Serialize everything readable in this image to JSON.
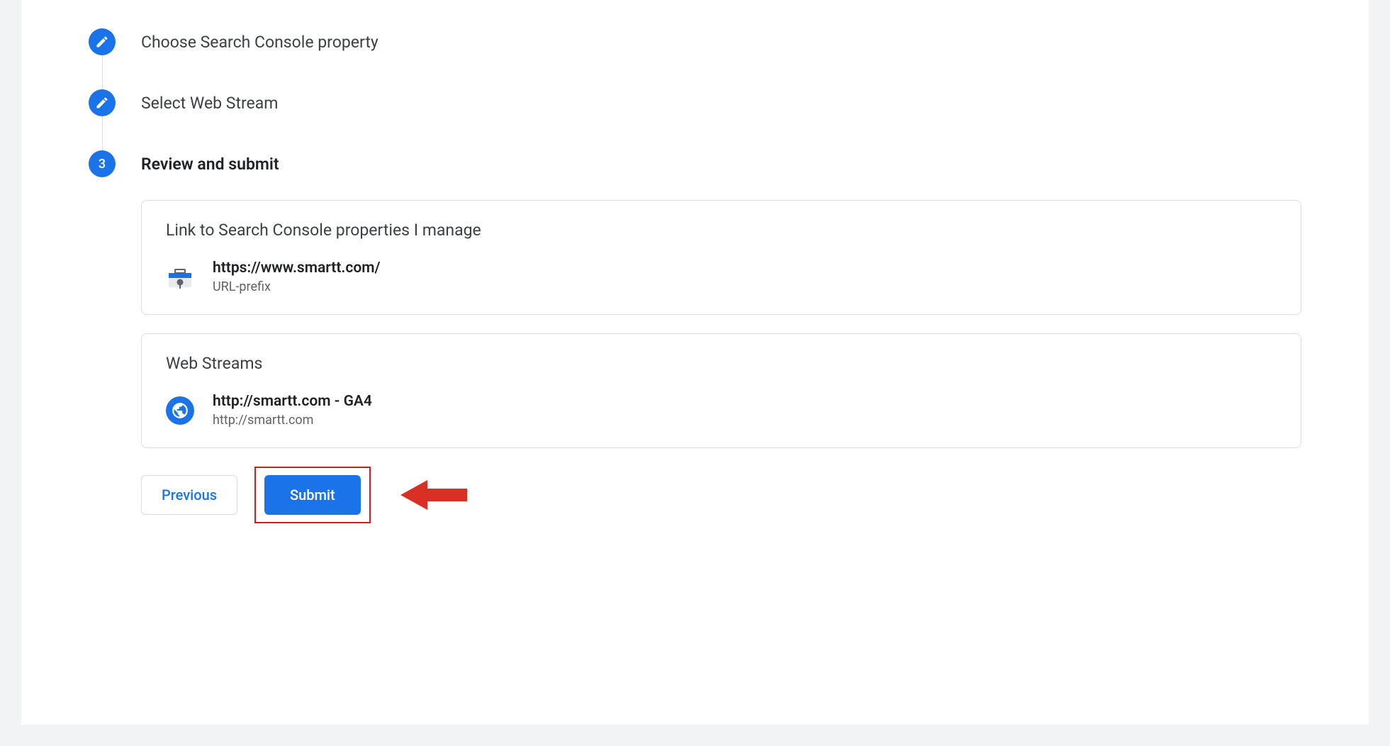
{
  "steps": {
    "one": {
      "label": "Choose Search Console property"
    },
    "two": {
      "label": "Select Web Stream"
    },
    "three": {
      "number": "3",
      "label": "Review and submit"
    }
  },
  "review": {
    "searchConsole": {
      "title": "Link to Search Console properties I manage",
      "url": "https://www.smartt.com/",
      "type": "URL-prefix"
    },
    "webStreams": {
      "title": "Web Streams",
      "name": "http://smartt.com - GA4",
      "url": "http://smartt.com"
    }
  },
  "actions": {
    "previous": "Previous",
    "submit": "Submit"
  }
}
